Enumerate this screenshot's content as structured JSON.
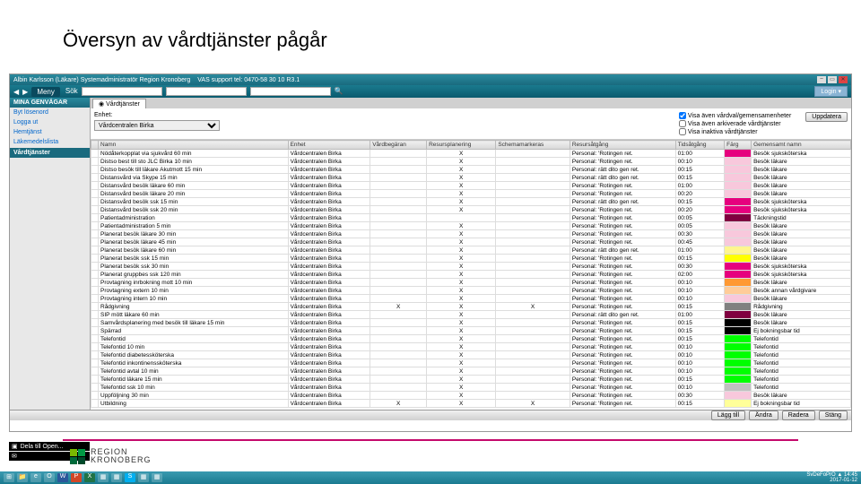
{
  "slide_title": "Översyn av vårdtjänster pågår",
  "titlebar": {
    "user": "Albin Karlsson (Läkare) Systemadministratör Region Kronoberg",
    "support": "VAS support tel: 0470-58 30 10  R3.1"
  },
  "toolbar": {
    "menu": "Meny",
    "login": "Login ▾",
    "search_ph_1": "",
    "search_ph_2": "",
    "search_ph_3": ""
  },
  "sidebar": {
    "header": "MINA GENVÄGAR",
    "items": [
      "Byt lösenord",
      "Logga ut",
      "Hemtjänst",
      "Läkemedelslista"
    ],
    "active": "Vårdtjänster",
    "tools": [
      "Dela till Open...",
      ""
    ]
  },
  "tab": {
    "label": "Vårdtjänster"
  },
  "filter": {
    "enhet_label": "Enhet:",
    "enhet_value": "Vårdcentralen Birka",
    "cb1": "Visa även vårdval/gemensamenheter",
    "cb2": "Visa även arkiverade vårdtjänster",
    "cb3": "Visa inaktiva vårdtjänster",
    "update": "Uppdatera"
  },
  "columns": [
    "",
    "Namn",
    "Enhet",
    "Vårdbegäran",
    "Resursplanering",
    "Schemamarkeras",
    "Resursåtgång",
    "Tidsåtgång",
    "Färg",
    "Gemensamt namn"
  ],
  "rows": [
    {
      "n": "Nödåterkopplat via sjukvård 60 min",
      "e": "Vårdcentralen Birka",
      "v": "",
      "r": "X",
      "s": "",
      "res": "Personal: 'Rotingen ret.",
      "t": "01:00",
      "c": "#e6007e",
      "g": "Besök sjuksköterska"
    },
    {
      "n": "Distso best till sto JLC Birka 10 min",
      "e": "Vårdcentralen Birka",
      "v": "",
      "r": "X",
      "s": "",
      "res": "Personal: 'Rotingen ret.",
      "t": "00:10",
      "c": "#f8c8dc",
      "g": "Besök läkare"
    },
    {
      "n": "Distso besök till läkare Akutmott 15 min",
      "e": "Vårdcentralen Birka",
      "v": "",
      "r": "X",
      "s": "",
      "res": "Personal: rätt dito gen ret.",
      "t": "00:15",
      "c": "#f8c8dc",
      "g": "Besök läkare"
    },
    {
      "n": "Distansvård via Skype 15 min",
      "e": "Vårdcentralen Birka",
      "v": "",
      "r": "X",
      "s": "",
      "res": "Personal: rätt dito gen ret.",
      "t": "00:15",
      "c": "#f8c8dc",
      "g": "Besök läkare"
    },
    {
      "n": "Distansvård besök läkare 60 min",
      "e": "Vårdcentralen Birka",
      "v": "",
      "r": "X",
      "s": "",
      "res": "Personal: 'Rotingen ret.",
      "t": "01:00",
      "c": "#f8c8dc",
      "g": "Besök läkare"
    },
    {
      "n": "Distansvård besök läkare 20 min",
      "e": "Vårdcentralen Birka",
      "v": "",
      "r": "X",
      "s": "",
      "res": "Personal: 'Rotingen ret.",
      "t": "00:20",
      "c": "#f8c8dc",
      "g": "Besök läkare"
    },
    {
      "n": "Distansvård besök ssk 15 min",
      "e": "Vårdcentralen Birka",
      "v": "",
      "r": "X",
      "s": "",
      "res": "Personal: rätt dito gen ret.",
      "t": "00:15",
      "c": "#e6007e",
      "g": "Besök sjuksköterska"
    },
    {
      "n": "Distansvård besök ssk 20 min",
      "e": "Vårdcentralen Birka",
      "v": "",
      "r": "X",
      "s": "",
      "res": "Personal: 'Rotingen ret.",
      "t": "00:20",
      "c": "#e6007e",
      "g": "Besök sjuksköterska"
    },
    {
      "n": "Patientadministration",
      "e": "Vårdcentralen Birka",
      "v": "",
      "r": "",
      "s": "",
      "res": "Personal: 'Rotingen ret.",
      "t": "00:05",
      "c": "#800040",
      "g": "Täckningstid"
    },
    {
      "n": "Patientadministration 5 min",
      "e": "Vårdcentralen Birka",
      "v": "",
      "r": "X",
      "s": "",
      "res": "Personal: 'Rotingen ret.",
      "t": "00:05",
      "c": "#f8c8dc",
      "g": "Besök läkare"
    },
    {
      "n": "Planerat besök läkare 30 min",
      "e": "Vårdcentralen Birka",
      "v": "",
      "r": "X",
      "s": "",
      "res": "Personal: 'Rotingen ret.",
      "t": "00:30",
      "c": "#f8c8dc",
      "g": "Besök läkare"
    },
    {
      "n": "Planerat besök läkare 45 min",
      "e": "Vårdcentralen Birka",
      "v": "",
      "r": "X",
      "s": "",
      "res": "Personal: 'Rotingen ret.",
      "t": "00:45",
      "c": "#f8c8dc",
      "g": "Besök läkare"
    },
    {
      "n": "Planerat besök läkare 60 min",
      "e": "Vårdcentralen Birka",
      "v": "",
      "r": "X",
      "s": "",
      "res": "Personal: rätt dito gen ret.",
      "t": "01:00",
      "c": "#fff68f",
      "g": "Besök läkare"
    },
    {
      "n": "Planerat besök ssk 15 min",
      "e": "Vårdcentralen Birka",
      "v": "",
      "r": "X",
      "s": "",
      "res": "Personal: 'Rotingen ret.",
      "t": "00:15",
      "c": "#ffff00",
      "g": "Besök läkare"
    },
    {
      "n": "Planerat besök ssk 30 min",
      "e": "Vårdcentralen Birka",
      "v": "",
      "r": "X",
      "s": "",
      "res": "Personal: 'Rotingen ret.",
      "t": "00:30",
      "c": "#e6007e",
      "g": "Besök sjuksköterska"
    },
    {
      "n": "Planerat gruppbes ssk 120 min",
      "e": "Vårdcentralen Birka",
      "v": "",
      "r": "X",
      "s": "",
      "res": "Personal: 'Rotingen ret.",
      "t": "02:00",
      "c": "#e6007e",
      "g": "Besök sjuksköterska"
    },
    {
      "n": "Provtagning inrbokning mott 10 min",
      "e": "Vårdcentralen Birka",
      "v": "",
      "r": "X",
      "s": "",
      "res": "Personal: 'Rotingen ret.",
      "t": "00:10",
      "c": "#ff9933",
      "g": "Besök läkare"
    },
    {
      "n": "Provtagning extern 10 min",
      "e": "Vårdcentralen Birka",
      "v": "",
      "r": "X",
      "s": "",
      "res": "Personal: 'Rotingen ret.",
      "t": "00:10",
      "c": "#ffcc99",
      "g": "Besök annan vårdgivare"
    },
    {
      "n": "Provtagning intern 10 min",
      "e": "Vårdcentralen Birka",
      "v": "",
      "r": "X",
      "s": "",
      "res": "Personal: 'Rotingen ret.",
      "t": "00:10",
      "c": "#f8c8dc",
      "g": "Besök läkare"
    },
    {
      "n": "Rådgivning",
      "e": "Vårdcentralen Birka",
      "v": "X",
      "r": "X",
      "s": "X",
      "res": "Personal: 'Rotingen ret.",
      "t": "00:15",
      "c": "#808080",
      "g": "Rådgivning"
    },
    {
      "n": "SIP mött läkare 60 min",
      "e": "Vårdcentralen Birka",
      "v": "",
      "r": "X",
      "s": "",
      "res": "Personal: rätt dito gen ret.",
      "t": "01:00",
      "c": "#800040",
      "g": "Besök läkare"
    },
    {
      "n": "Samvårdsplanering med besök till läkare 15 min",
      "e": "Vårdcentralen Birka",
      "v": "",
      "r": "X",
      "s": "",
      "res": "Personal: 'Rotingen ret.",
      "t": "00:15",
      "c": "#000000",
      "g": "Besök läkare"
    },
    {
      "n": "Spärrad",
      "e": "Vårdcentralen Birka",
      "v": "",
      "r": "X",
      "s": "",
      "res": "Personal: 'Rotingen ret.",
      "t": "00:15",
      "c": "#000000",
      "g": "Ej bokningsbar tid"
    },
    {
      "n": "Telefontid",
      "e": "Vårdcentralen Birka",
      "v": "",
      "r": "X",
      "s": "",
      "res": "Personal: 'Rotingen ret.",
      "t": "00:15",
      "c": "#00ff00",
      "g": "Telefontid"
    },
    {
      "n": "Telefontid 10 min",
      "e": "Vårdcentralen Birka",
      "v": "",
      "r": "X",
      "s": "",
      "res": "Personal: 'Rotingen ret.",
      "t": "00:10",
      "c": "#00ff00",
      "g": "Telefontid"
    },
    {
      "n": "Telefontid diabetessköterska",
      "e": "Vårdcentralen Birka",
      "v": "",
      "r": "X",
      "s": "",
      "res": "Personal: 'Rotingen ret.",
      "t": "00:10",
      "c": "#00ff00",
      "g": "Telefontid"
    },
    {
      "n": "Telefontid inkontinenssköterska",
      "e": "Vårdcentralen Birka",
      "v": "",
      "r": "X",
      "s": "",
      "res": "Personal: 'Rotingen ret.",
      "t": "00:10",
      "c": "#00ff00",
      "g": "Telefontid"
    },
    {
      "n": "Telefontid avtal 10 min",
      "e": "Vårdcentralen Birka",
      "v": "",
      "r": "X",
      "s": "",
      "res": "Personal: 'Rotingen ret.",
      "t": "00:10",
      "c": "#00ff00",
      "g": "Telefontid"
    },
    {
      "n": "Telefontid läkare 15 min",
      "e": "Vårdcentralen Birka",
      "v": "",
      "r": "X",
      "s": "",
      "res": "Personal: 'Rotingen ret.",
      "t": "00:15",
      "c": "#00ff00",
      "g": "Telefontid"
    },
    {
      "n": "Telefontid ssk 10 min",
      "e": "Vårdcentralen Birka",
      "v": "",
      "r": "X",
      "s": "",
      "res": "Personal: 'Rotingen ret.",
      "t": "00:10",
      "c": "#c0c0c0",
      "g": "Telefontid"
    },
    {
      "n": "Uppföljning 30 min",
      "e": "Vårdcentralen Birka",
      "v": "",
      "r": "X",
      "s": "",
      "res": "Personal: 'Rotingen ret.",
      "t": "00:30",
      "c": "#f8c8dc",
      "g": "Besök läkare"
    },
    {
      "n": "Utbildning",
      "e": "Vårdcentralen Birka",
      "v": "X",
      "r": "X",
      "s": "X",
      "res": "Personal: 'Rotingen ret.",
      "t": "00:15",
      "c": "#ffff99",
      "g": "Ej bokningsbar tid"
    }
  ],
  "status_buttons": [
    "Lägg till",
    "Ändra",
    "Radera",
    "Stäng"
  ],
  "clock": {
    "t": "14:45",
    "d": "2017-01-12",
    "sig": "SvDeFoPrO"
  },
  "logo": {
    "l1": "REGION",
    "l2": "KRONOBERG"
  }
}
